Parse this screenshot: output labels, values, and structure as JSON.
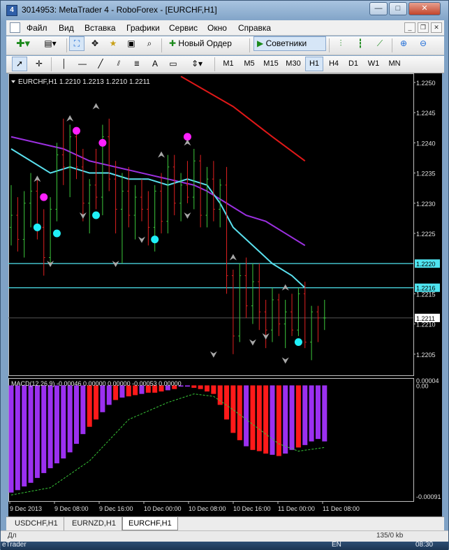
{
  "window": {
    "title": "3014953: MetaTrader 4 - RoboForex - [EURCHF,H1]"
  },
  "window_buttons": {
    "minimize": "—",
    "maximize": "□",
    "close": "✕"
  },
  "menu": [
    "Файл",
    "Вид",
    "Вставка",
    "Графики",
    "Сервис",
    "Окно",
    "Справка"
  ],
  "toolbar1": {
    "new_order": "Новый Ордер",
    "experts": "Советники"
  },
  "timeframes": [
    "M1",
    "M5",
    "M15",
    "M30",
    "H1",
    "H4",
    "D1",
    "W1",
    "MN"
  ],
  "active_timeframe": "H1",
  "chart": {
    "header": "EURCHF,H1  1.2210 1.2213 1.2210 1.2211",
    "price_labels": [
      "1.2250",
      "1.2245",
      "1.2240",
      "1.2235",
      "1.2230",
      "1.2225",
      "1.2220",
      "1.2216",
      "1.2215",
      "1.2211",
      "1.2210",
      "1.2205"
    ],
    "macd_header": "MACD(12,26,9) -0.00046 0.00000 0.00000 -0.00053 0.00000",
    "macd_labels": [
      "0.00004",
      "0.00",
      "-0.00091"
    ],
    "time_labels": [
      "9 Dec 2013",
      "9 Dec 08:00",
      "9 Dec 16:00",
      "10 Dec 00:00",
      "10 Dec 08:00",
      "10 Dec 16:00",
      "11 Dec 00:00",
      "11 Dec 08:00"
    ]
  },
  "chart_data": {
    "type": "candlestick",
    "symbol": "EURCHF",
    "timeframe": "H1",
    "ylim": [
      1.22015,
      1.22515
    ],
    "current_price": 1.2211,
    "horizontal_lines": [
      1.222,
      1.2216
    ],
    "bars": [
      [
        1.2226,
        1.2233,
        1.2223,
        1.2228
      ],
      [
        1.2228,
        1.2231,
        1.2222,
        1.2224
      ],
      [
        1.2224,
        1.2232,
        1.2221,
        1.223
      ],
      [
        1.223,
        1.2235,
        1.2226,
        1.2232
      ],
      [
        1.2232,
        1.2234,
        1.2224,
        1.2226
      ],
      [
        1.2226,
        1.2229,
        1.2218,
        1.2221
      ],
      [
        1.2221,
        1.2231,
        1.222,
        1.2229
      ],
      [
        1.2229,
        1.224,
        1.2227,
        1.2238
      ],
      [
        1.2238,
        1.2244,
        1.2233,
        1.2236
      ],
      [
        1.2236,
        1.2243,
        1.2231,
        1.2241
      ],
      [
        1.2241,
        1.2242,
        1.2234,
        1.2236
      ],
      [
        1.2236,
        1.2239,
        1.2227,
        1.223
      ],
      [
        1.223,
        1.2234,
        1.2225,
        1.2233
      ],
      [
        1.2233,
        1.2239,
        1.2229,
        1.2231
      ],
      [
        1.2231,
        1.2243,
        1.2228,
        1.2241
      ],
      [
        1.2241,
        1.2244,
        1.2232,
        1.2234
      ],
      [
        1.2234,
        1.2237,
        1.2225,
        1.2229
      ],
      [
        1.2229,
        1.2235,
        1.222,
        1.2232
      ],
      [
        1.2232,
        1.2236,
        1.2226,
        1.2228
      ],
      [
        1.2228,
        1.2233,
        1.2224,
        1.2231
      ],
      [
        1.2231,
        1.2234,
        1.2227,
        1.2229
      ],
      [
        1.2229,
        1.2232,
        1.2223,
        1.2226
      ],
      [
        1.2226,
        1.2233,
        1.2222,
        1.2232
      ],
      [
        1.2232,
        1.2235,
        1.2225,
        1.2227
      ],
      [
        1.2227,
        1.2238,
        1.2225,
        1.2236
      ],
      [
        1.2236,
        1.2238,
        1.2228,
        1.223
      ],
      [
        1.223,
        1.2235,
        1.2227,
        1.2233
      ],
      [
        1.2233,
        1.2237,
        1.223,
        1.2231
      ],
      [
        1.2231,
        1.2239,
        1.2229,
        1.2237
      ],
      [
        1.2237,
        1.2238,
        1.2226,
        1.2228
      ],
      [
        1.2228,
        1.2236,
        1.2226,
        1.2234
      ],
      [
        1.2234,
        1.2237,
        1.2227,
        1.2229
      ],
      [
        1.2229,
        1.2234,
        1.2226,
        1.2233
      ],
      [
        1.2233,
        1.2236,
        1.2215,
        1.2218
      ],
      [
        1.2218,
        1.2219,
        1.2205,
        1.2208
      ],
      [
        1.2208,
        1.222,
        1.2207,
        1.2218
      ],
      [
        1.2218,
        1.2221,
        1.2211,
        1.2213
      ],
      [
        1.2213,
        1.222,
        1.221,
        1.2217
      ],
      [
        1.2217,
        1.222,
        1.2209,
        1.2212
      ],
      [
        1.2212,
        1.2214,
        1.2206,
        1.2209
      ],
      [
        1.2209,
        1.2216,
        1.2207,
        1.2214
      ],
      [
        1.2214,
        1.2215,
        1.2208,
        1.221
      ],
      [
        1.221,
        1.2214,
        1.2206,
        1.2212
      ],
      [
        1.2212,
        1.2215,
        1.2208,
        1.2209
      ],
      [
        1.2209,
        1.2216,
        1.2208,
        1.2215
      ],
      [
        1.2215,
        1.2217,
        1.2206,
        1.2207
      ],
      [
        1.2207,
        1.2213,
        1.2204,
        1.2212
      ],
      [
        1.2212,
        1.2213,
        1.2207,
        1.2211
      ],
      [
        1.2211,
        1.2214,
        1.2209,
        1.2211
      ]
    ],
    "ma_red": [
      [
        26,
        1.2251
      ],
      [
        34,
        1.2246
      ],
      [
        40,
        1.2241
      ],
      [
        45,
        1.2237
      ]
    ],
    "ma_purple": [
      [
        0,
        1.2241
      ],
      [
        4,
        1.224
      ],
      [
        8,
        1.2239
      ],
      [
        12,
        1.2237
      ],
      [
        16,
        1.2236
      ],
      [
        20,
        1.2235
      ],
      [
        24,
        1.2234
      ],
      [
        28,
        1.2233
      ],
      [
        30,
        1.2232
      ],
      [
        33,
        1.223
      ],
      [
        36,
        1.2228
      ],
      [
        39,
        1.2227
      ],
      [
        42,
        1.2225
      ],
      [
        45,
        1.2223
      ]
    ],
    "ma_cyan": [
      [
        0,
        1.2239
      ],
      [
        3,
        1.2237
      ],
      [
        6,
        1.2235
      ],
      [
        9,
        1.2236
      ],
      [
        12,
        1.2235
      ],
      [
        15,
        1.2235
      ],
      [
        18,
        1.2234
      ],
      [
        21,
        1.2234
      ],
      [
        24,
        1.2233
      ],
      [
        27,
        1.2234
      ],
      [
        30,
        1.2233
      ],
      [
        32,
        1.223
      ],
      [
        34,
        1.2226
      ],
      [
        37,
        1.2223
      ],
      [
        40,
        1.222
      ],
      [
        43,
        1.2218
      ],
      [
        45,
        1.2216
      ]
    ],
    "dots_magenta": [
      [
        5,
        1.2231
      ],
      [
        10,
        1.2242
      ],
      [
        14,
        1.224
      ],
      [
        27,
        1.2241
      ]
    ],
    "dots_cyan": [
      [
        4,
        1.2226
      ],
      [
        7,
        1.2225
      ],
      [
        13,
        1.2228
      ],
      [
        22,
        1.2224
      ],
      [
        44,
        1.2207
      ]
    ],
    "arrows_up": [
      [
        4,
        1.2234
      ],
      [
        9,
        1.2244
      ],
      [
        13,
        1.2246
      ],
      [
        23,
        1.2238
      ],
      [
        27,
        1.224
      ],
      [
        34,
        1.2221
      ],
      [
        42,
        1.2216
      ]
    ],
    "arrows_down": [
      [
        6,
        1.222
      ],
      [
        11,
        1.2228
      ],
      [
        16,
        1.222
      ],
      [
        20,
        1.2224
      ],
      [
        27,
        1.2228
      ],
      [
        31,
        1.2205
      ],
      [
        37,
        1.2207
      ],
      [
        39,
        1.2208
      ],
      [
        42,
        1.2204
      ]
    ],
    "macd": {
      "ylim": [
        -0.00095,
        6e-05
      ],
      "histogram": [
        -0.00088,
        -0.00086,
        -0.00083,
        -0.0008,
        -0.00076,
        -0.00072,
        -0.00068,
        -0.00064,
        -0.0006,
        -0.00055,
        -0.00048,
        -0.0004,
        -0.00034,
        -0.00028,
        -0.00022,
        -0.00016,
        -0.00012,
        -0.0001,
        -9e-05,
        -8e-05,
        -7e-05,
        -6e-05,
        -6e-05,
        -5e-05,
        -4e-05,
        -3e-05,
        -1e-05,
        -1e-05,
        -2e-05,
        -3e-05,
        -5e-05,
        -7e-05,
        -0.00016,
        -0.00028,
        -0.00039,
        -0.00045,
        -0.0005,
        -0.00053,
        -0.00054,
        -0.00056,
        -0.00057,
        -0.00058,
        -0.00056,
        -0.00053,
        -0.00051,
        -0.00049,
        -0.00046,
        -0.00044,
        -0.00046
      ],
      "colors": [
        "p",
        "p",
        "p",
        "p",
        "p",
        "p",
        "p",
        "p",
        "p",
        "p",
        "p",
        "p",
        "r",
        "r",
        "p",
        "p",
        "r",
        "p",
        "r",
        "r",
        "p",
        "r",
        "r",
        "r",
        "p",
        "r",
        "p",
        "p",
        "r",
        "r",
        "r",
        "r",
        "r",
        "r",
        "r",
        "r",
        "p",
        "r",
        "r",
        "r",
        "p",
        "r",
        "p",
        "p",
        "r",
        "p",
        "p",
        "p",
        "p"
      ],
      "signal": [
        [
          0,
          -0.0009
        ],
        [
          6,
          -0.00084
        ],
        [
          12,
          -0.00062
        ],
        [
          18,
          -0.00028
        ],
        [
          24,
          -0.00014
        ],
        [
          28,
          -7e-05
        ],
        [
          31,
          -9e-05
        ],
        [
          34,
          -0.0002
        ],
        [
          38,
          -0.00036
        ],
        [
          41,
          -0.00048
        ],
        [
          44,
          -0.00054
        ],
        [
          48,
          -0.00051
        ]
      ]
    }
  },
  "tabs": [
    "USDCHF,H1",
    "EURNZD,H1",
    "EURCHF,H1"
  ],
  "active_tab": "EURCHF,H1",
  "status": {
    "left": "Дл",
    "traffic": "135/0 kb"
  },
  "taskbar": {
    "app": "eTrader",
    "lang": "EN",
    "time": "08:30"
  }
}
